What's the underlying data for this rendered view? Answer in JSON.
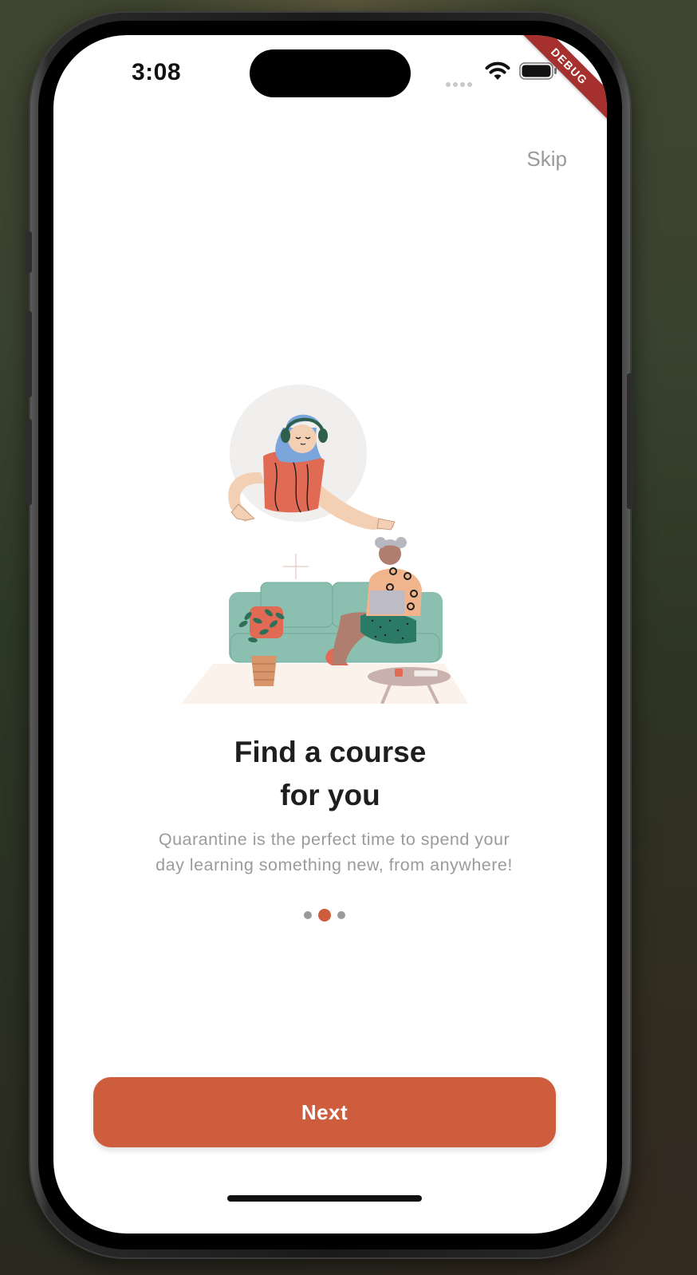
{
  "status_bar": {
    "time": "3:08"
  },
  "debug_banner": "DEBUG",
  "onboarding": {
    "skip_label": "Skip",
    "title_line1": "Find a course",
    "title_line2": "for you",
    "subtitle_line1": "Quarantine is the perfect time to spend your",
    "subtitle_line2": "day learning something new, from anywhere!",
    "page_indicator": {
      "count": 3,
      "active_index": 1
    },
    "next_label": "Next"
  },
  "colors": {
    "accent": "#cd5d3c",
    "dot_inactive": "#9a9a9a",
    "title": "#1e1e1e",
    "subtitle": "#9b9b9b",
    "sofa": "#8bc0b1",
    "shirt": "#e06a54"
  },
  "icons": [
    "wifi-icon",
    "battery-icon",
    "signal-dots-icon"
  ]
}
